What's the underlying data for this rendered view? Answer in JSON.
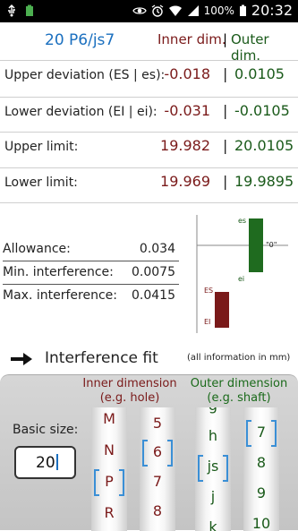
{
  "status_bar": {
    "battery": "100%",
    "time": "20:32"
  },
  "header": {
    "fit_code": "20 P6/js7",
    "inner_title": "Inner dim.",
    "separator": "|",
    "outer_title": "Outer dim."
  },
  "rows": [
    {
      "label": "Upper deviation (ES | es):",
      "inner": "-0.018",
      "outer": "0.0105"
    },
    {
      "label": "Lower deviation (EI | ei):",
      "inner": "-0.031",
      "outer": "-0.0105"
    },
    {
      "label": "Upper limit:",
      "inner": "19.982",
      "outer": "20.0105"
    },
    {
      "label": "Lower limit:",
      "inner": "19.969",
      "outer": "19.9895"
    }
  ],
  "summary": [
    {
      "label": "Allowance:",
      "value": "0.034"
    },
    {
      "label": "Min. interference:",
      "value": "0.0075"
    },
    {
      "label": "Max. interference:",
      "value": "0.0415"
    }
  ],
  "diagram": {
    "es_label": "es",
    "ei_label": "ei",
    "ES_label": "ES",
    "EI_label": "EI",
    "zero_label": "\"0\"",
    "colors": {
      "shaft": "#1f6b1f",
      "hole": "#7a1a1a"
    }
  },
  "fit": {
    "type": "Interference fit",
    "info": "(all information in mm)"
  },
  "selector": {
    "inner_title_1": "Inner dimension",
    "inner_title_2": "(e.g. hole)",
    "outer_title_1": "Outer dimension",
    "outer_title_2": "(e.g. shaft)",
    "basic_size_label": "Basic size:",
    "basic_size_value": "20",
    "hole_letters": [
      "M",
      "N",
      "P",
      "R"
    ],
    "hole_grades": [
      "5",
      "6",
      "7",
      "8"
    ],
    "shaft_letters": [
      "g",
      "h",
      "js",
      "j",
      "k"
    ],
    "shaft_grades": [
      "7",
      "8",
      "9",
      "10"
    ],
    "selected": {
      "hole_letter": "P",
      "hole_grade": "6",
      "shaft_letter": "js",
      "shaft_grade": "7"
    }
  }
}
